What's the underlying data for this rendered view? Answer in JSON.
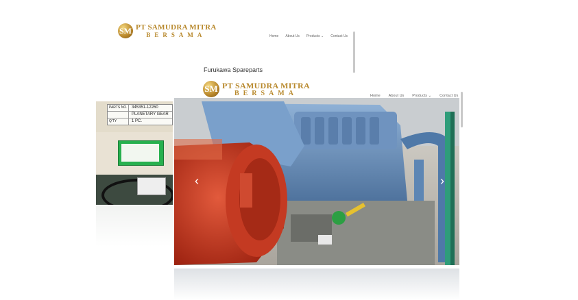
{
  "brand": {
    "monogram": "SM",
    "line1": "PT SAMUDRA MITRA",
    "line2": "BERSAMA"
  },
  "back_page": {
    "nav": [
      "Home",
      "About Us",
      "Products ⌄",
      "Contact Us"
    ],
    "section_title": "Furukawa Spareparts",
    "thumbs": {
      "label1": {
        "rows": [
          {
            "k": "PARTS NO.",
            "v": "345351-12260"
          },
          {
            "k": "",
            "v": "PLANETARY GEAR"
          },
          {
            "k": "Q'TY",
            "v": "1 PC."
          }
        ]
      }
    }
  },
  "front_page": {
    "nav": [
      "Home",
      "About Us",
      "Products ⌄",
      "Contact Us"
    ],
    "slider": {
      "prev_icon": "‹",
      "next_icon": "›"
    }
  }
}
